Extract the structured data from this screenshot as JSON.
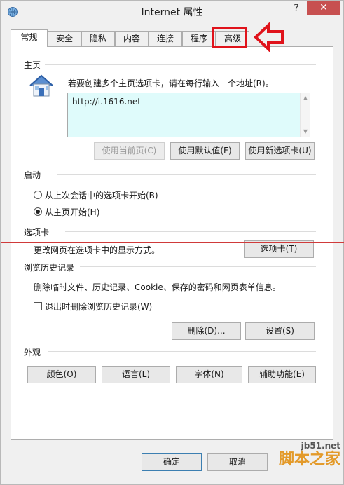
{
  "window": {
    "title": "Internet 属性",
    "help_label": "?",
    "close_label": "✕"
  },
  "tabs": [
    {
      "label": "常规",
      "active": true
    },
    {
      "label": "安全"
    },
    {
      "label": "隐私"
    },
    {
      "label": "内容"
    },
    {
      "label": "连接"
    },
    {
      "label": "程序"
    },
    {
      "label": "高级"
    }
  ],
  "home": {
    "section_title": "主页",
    "hint": "若要创建多个主页选项卡，请在每行输入一个地址(R)。",
    "url_value": "http://i.1616.net",
    "buttons": {
      "use_current": "使用当前页(C)",
      "use_default": "使用默认值(F)",
      "use_new_tab": "使用新选项卡(U)"
    }
  },
  "startup": {
    "section_title": "启动",
    "option_last_session": "从上次会话中的选项卡开始(B)",
    "option_home": "从主页开始(H)",
    "selected": "home"
  },
  "tabs_section": {
    "section_title": "选项卡",
    "description": "更改网页在选项卡中的显示方式。",
    "button": "选项卡(T)"
  },
  "history": {
    "section_title": "浏览历史记录",
    "description": "删除临时文件、历史记录、Cookie、保存的密码和网页表单信息。",
    "checkbox_label": "退出时删除浏览历史记录(W)",
    "checked": false,
    "delete_button": "删除(D)...",
    "settings_button": "设置(S)"
  },
  "appearance": {
    "section_title": "外观",
    "colors_button": "颜色(O)",
    "languages_button": "语言(L)",
    "fonts_button": "字体(N)",
    "accessibility_button": "辅助功能(E)"
  },
  "footer": {
    "ok_button": "确定",
    "cancel_button": "取消"
  },
  "watermark": {
    "url": "jb51.net",
    "text": "脚本之家"
  },
  "colors": {
    "annotation_red": "#e0131b",
    "url_box_bg": "#dffbfb",
    "close_button": "#c75050"
  }
}
